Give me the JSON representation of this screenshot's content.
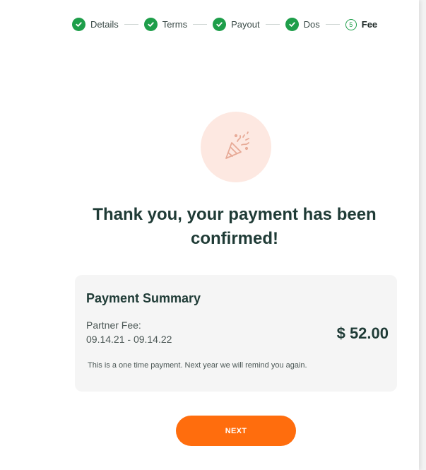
{
  "stepper": {
    "steps": [
      {
        "label": "Details",
        "status": "complete"
      },
      {
        "label": "Terms",
        "status": "complete"
      },
      {
        "label": "Payout",
        "status": "complete"
      },
      {
        "label": "Dos",
        "status": "complete"
      },
      {
        "label": "Fee",
        "status": "current",
        "number": "5"
      }
    ]
  },
  "hero": {
    "icon": "party-popper-icon"
  },
  "confirmation": {
    "title": "Thank you, your payment has been confirmed!"
  },
  "summary": {
    "heading": "Payment Summary",
    "fee_label": "Partner Fee:",
    "fee_dates": "09.14.21 - 09.14.22",
    "amount": "$ 52.00",
    "note": "This is a one time payment. Next year we will remind you again."
  },
  "actions": {
    "next_label": "NEXT"
  },
  "colors": {
    "accent": "#ff6d0d",
    "success": "#1e9e4a",
    "heading": "#1f3b36",
    "hero_bg": "#fde8e1"
  }
}
